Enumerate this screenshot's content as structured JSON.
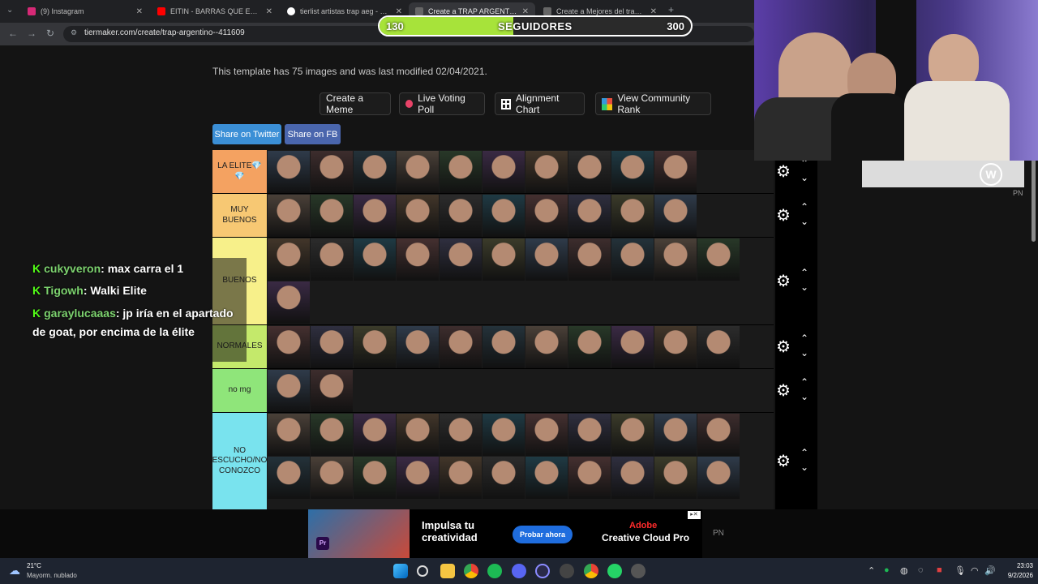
{
  "browser": {
    "tabs": [
      {
        "title": "(9) Instagram",
        "icon": "instagram-icon",
        "color": "#d62976"
      },
      {
        "title": "EITIN - BARRAS QUE ESTALLAN",
        "icon": "youtube-icon",
        "color": "#ff0000"
      },
      {
        "title": "tierlist artistas trap aeg - Busca",
        "icon": "google-icon",
        "color": "#ffffff"
      },
      {
        "title": "Create a TRAP ARGENTINO Tie",
        "icon": "tiermaker-icon",
        "color": "#444444"
      },
      {
        "title": "Create a Mejores del trap arge",
        "icon": "tiermaker-icon",
        "color": "#444444"
      }
    ],
    "new_tab": "+",
    "url": "tiermaker.com/create/trap-argentino--411609"
  },
  "page": {
    "template_info": "This template has 75 images and was last modified 02/04/2021.",
    "buttons": {
      "create_meme": "Create a Meme",
      "live_voting": "Live Voting Poll",
      "alignment_chart": "Alignment Chart",
      "community_rank": "View Community Rank"
    },
    "share": {
      "twitter": "Share on Twitter",
      "fb": "Share on FB"
    },
    "side_label": "PN",
    "tiers": [
      {
        "label": "LA ELITE💎💎",
        "color": "#f4a261",
        "count": 10
      },
      {
        "label": "MUY BUENOS",
        "color": "#f7c873",
        "count": 10
      },
      {
        "label": "BUENOS",
        "color": "#f7f08a",
        "count": 12
      },
      {
        "label": "NORMALES",
        "color": "#c4e96b",
        "count": 11
      },
      {
        "label": "no mg",
        "color": "#8fe57a",
        "count": 2
      },
      {
        "label": "NO ESCUCHO/NO CONOZCO",
        "color": "#79e3ee",
        "count": 22
      }
    ]
  },
  "chat": [
    {
      "user": "cukyveron",
      "message": ": max carra el 1"
    },
    {
      "user": "Tigowh",
      "message": ": Walki Elite"
    },
    {
      "user": "garaylucaaas",
      "message": ": jp iría en el apartado de goat, por encima de la élite"
    }
  ],
  "followers": {
    "current": "130",
    "label": "SEGUIDORES",
    "goal": "300",
    "progress": 0.43
  },
  "ad": {
    "headline": "Impulsa tu creatividad",
    "cta": "Probar ahora",
    "brand_top": "Adobe",
    "brand_bottom": "Creative Cloud Pro",
    "side_label": "PN"
  },
  "taskbar": {
    "weather_temp": "21°C",
    "weather_desc": "Mayorm. nublado",
    "time": "23:03",
    "date": "9/2/2026"
  }
}
